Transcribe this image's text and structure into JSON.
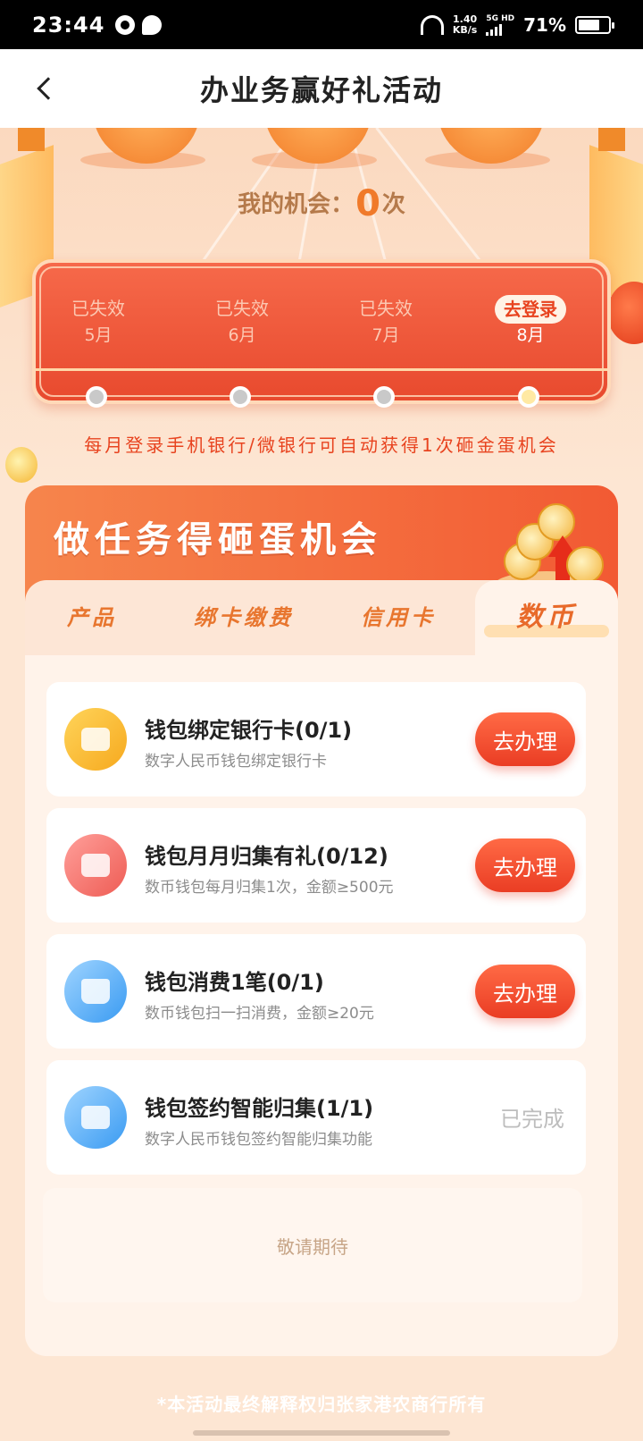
{
  "status_bar": {
    "time": "23:44",
    "net_speed_value": "1.40",
    "net_speed_unit": "KB/s",
    "net_type": "5G HD",
    "battery": "71%",
    "battery_level": 0.71
  },
  "nav": {
    "title": "办业务赢好礼活动"
  },
  "chances": {
    "label": "我的机会：",
    "count": "0",
    "unit": "次"
  },
  "login_months": [
    {
      "status": "已失效",
      "month": "5月"
    },
    {
      "status": "已失效",
      "month": "6月"
    },
    {
      "status": "已失效",
      "month": "7月"
    },
    {
      "status": "去登录",
      "month": "8月"
    }
  ],
  "login_tip": "每月登录手机银行/微银行可自动获得1次砸金蛋机会",
  "task_section": {
    "title": "做任务得砸蛋机会",
    "tabs": [
      "产品",
      "绑卡缴费",
      "信用卡",
      "数币"
    ],
    "active_tab": "数币",
    "tasks": [
      {
        "name": "钱包绑定银行卡(0/1)",
        "desc": "数字人民币钱包绑定银行卡",
        "action": "去办理",
        "icon": "card-link-icon"
      },
      {
        "name": "钱包月月归集有礼(0/12)",
        "desc": "数币钱包每月归集1次，金额≥500元",
        "action": "去办理",
        "icon": "collect-icon"
      },
      {
        "name": "钱包消费1笔(0/1)",
        "desc": "数币钱包扫一扫消费，金额≥20元",
        "action": "去办理",
        "icon": "shopping-bag-icon"
      },
      {
        "name": "钱包签约智能归集(1/1)",
        "desc": "数字人民币钱包签约智能归集功能",
        "action": "已完成",
        "icon": "download-box-icon"
      }
    ],
    "coming_soon": "敬请期待"
  },
  "footer_note": "*本活动最终解释权归张家港农商行所有",
  "colors": {
    "accent": "#ea3d24",
    "background": "#fde6d3",
    "tab_text": "#e8762f"
  }
}
